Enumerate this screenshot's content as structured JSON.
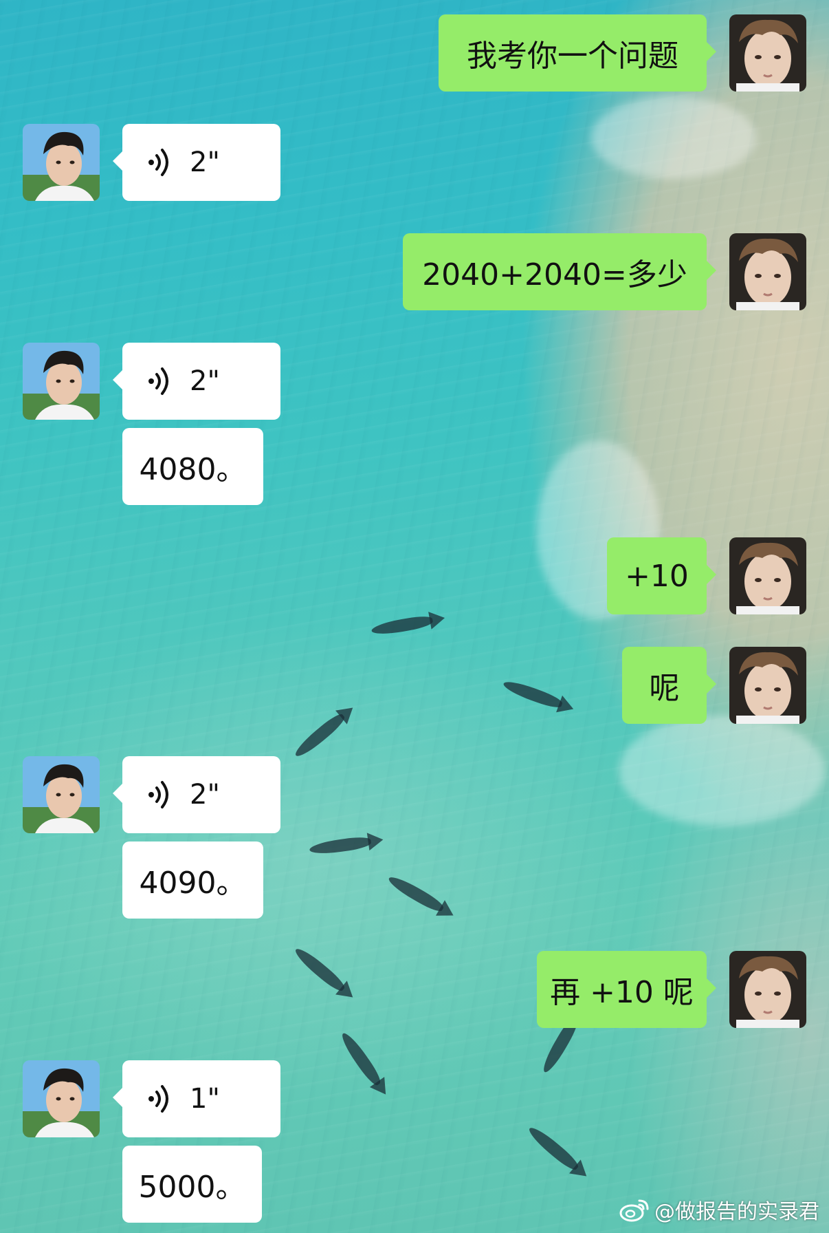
{
  "messages": [
    {
      "side": "right",
      "type": "text",
      "text": "我考你一个问题"
    },
    {
      "side": "left",
      "type": "voice",
      "duration": "2\""
    },
    {
      "side": "right",
      "type": "text",
      "text": "2040+2040=多少"
    },
    {
      "side": "left",
      "type": "voice",
      "duration": "2\""
    },
    {
      "side": "left",
      "type": "text",
      "text": "4080。"
    },
    {
      "side": "right",
      "type": "text",
      "text": "+10"
    },
    {
      "side": "right",
      "type": "text",
      "text": "呢"
    },
    {
      "side": "left",
      "type": "voice",
      "duration": "2\""
    },
    {
      "side": "left",
      "type": "text",
      "text": "4090。"
    },
    {
      "side": "right",
      "type": "text",
      "text": "再 +10 呢"
    },
    {
      "side": "left",
      "type": "voice",
      "duration": "1\""
    },
    {
      "side": "left",
      "type": "text",
      "text": "5000。"
    }
  ],
  "watermark": {
    "text": "@做报告的实录君",
    "icon": "weibo-icon"
  },
  "colors": {
    "outgoing_bubble": "#95ec69",
    "incoming_bubble": "#ffffff"
  }
}
